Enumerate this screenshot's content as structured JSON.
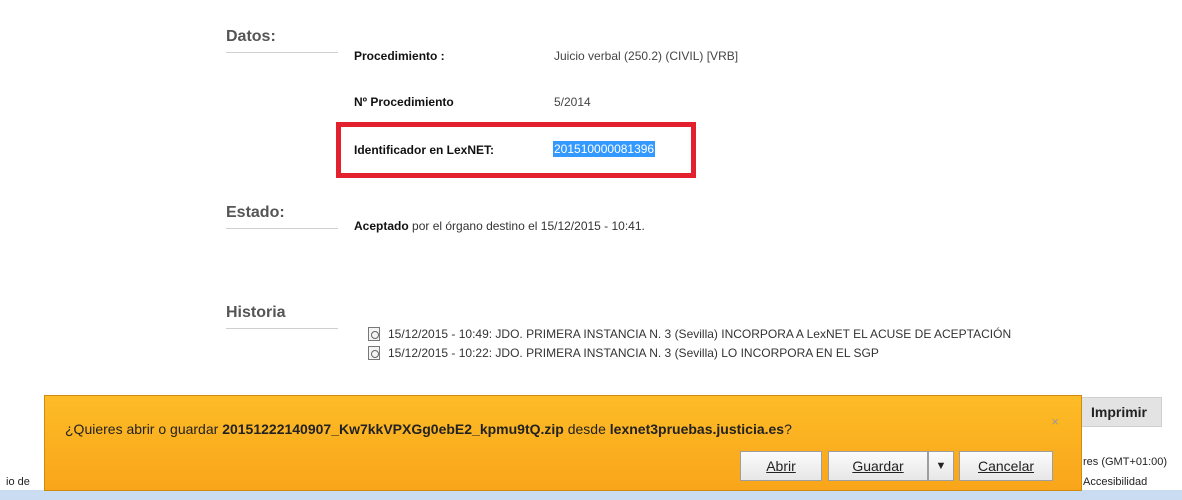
{
  "sections": {
    "datos_label": "Datos:",
    "estado_label": "Estado:",
    "historia_label": "Historia"
  },
  "datos": {
    "procedimiento_label": "Procedimiento :",
    "procedimiento_value": "Juicio verbal (250.2) (CIVIL) [VRB]",
    "num_label": "Nº Procedimiento",
    "num_value": "5/2014",
    "lexnet_label": "Identificador en LexNET:",
    "lexnet_value": "201510000081396"
  },
  "estado": {
    "status_bold": "Aceptado",
    "status_rest": " por el órgano destino el 15/12/2015 - 10:41."
  },
  "historia": {
    "items": [
      "15/12/2015 - 10:49: JDO. PRIMERA INSTANCIA N. 3 (Sevilla) INCORPORA A LexNET EL ACUSE DE ACEPTACIÓN",
      "15/12/2015 - 10:22: JDO. PRIMERA INSTANCIA N. 3 (Sevilla) LO INCORPORA EN EL SGP"
    ]
  },
  "actions": {
    "print_label": "Imprimir"
  },
  "footer": {
    "timezone": "res (GMT+01:00)",
    "accessibility": "Accesibilidad",
    "left_text": "io de"
  },
  "download_bar": {
    "prefix": "¿Quieres abrir o guardar ",
    "filename": "20151222140907_Kw7kkVPXGg0ebE2_kpmu9tQ.zip",
    "middle": " desde ",
    "source": "lexnet3pruebas.justicia.es",
    "suffix": "?",
    "open_label": "Abrir",
    "save_label": "Guardar",
    "cancel_label": "Cancelar",
    "close_symbol": "×",
    "dropdown_symbol": "▼"
  },
  "colors": {
    "highlight_border": "#e3202d",
    "download_bar": "#f9a51a",
    "selection": "#3399ff"
  }
}
